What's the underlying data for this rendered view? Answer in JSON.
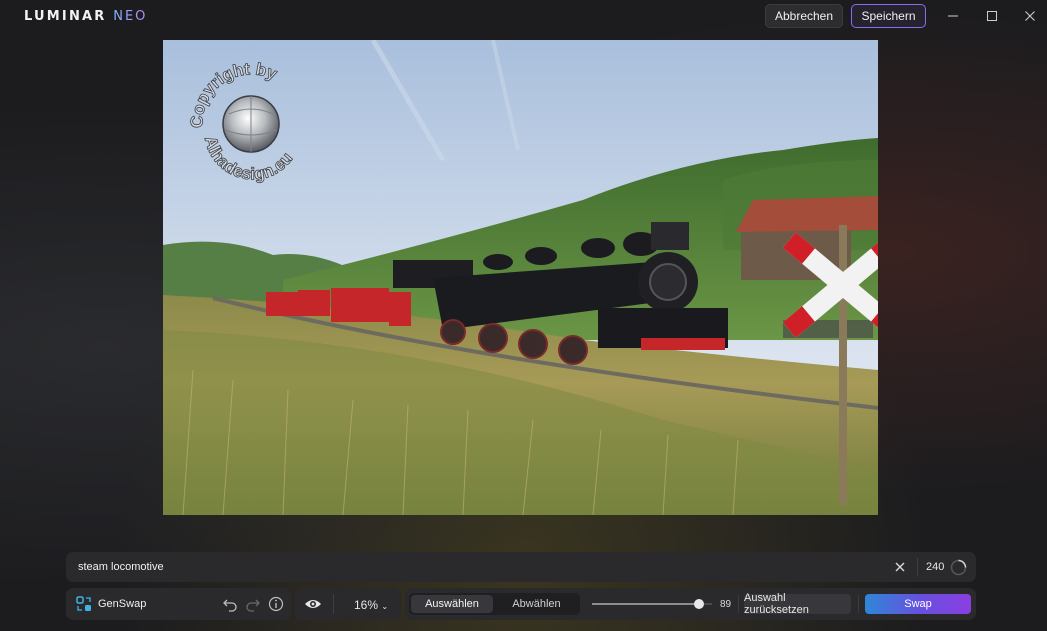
{
  "app": {
    "logo_main": "LUMINAR ",
    "logo_neo": "NEO",
    "cancel_label": "Abbrechen",
    "save_label": "Speichern"
  },
  "image": {
    "watermark_top": "Copyright by",
    "watermark_bottom": "Alhadesign.eu",
    "subject": "steam locomotive"
  },
  "prompt": {
    "value": "steam locomotive",
    "counter": "240"
  },
  "toolbar": {
    "tool_name": "GenSwap",
    "zoom": "16%",
    "select_label": "Auswählen",
    "deselect_label": "Abwählen",
    "brush_size": "89",
    "brush_size_value": 89,
    "brush_size_max": 100,
    "reset_selection_label": "Auswahl zurücksetzen",
    "swap_label": "Swap"
  },
  "colors": {
    "accent": "#8a6cf0",
    "swap_gradient_start": "#2f86d8",
    "swap_gradient_end": "#8a3fe0"
  },
  "icons": {
    "gen_swap": "genswap-icon",
    "undo": "undo-icon",
    "redo": "redo-icon",
    "info": "info-icon",
    "preview": "eye-icon",
    "zoom_menu": "chevron-down-icon",
    "clear": "close-icon",
    "progress": "loading-ring-icon"
  }
}
